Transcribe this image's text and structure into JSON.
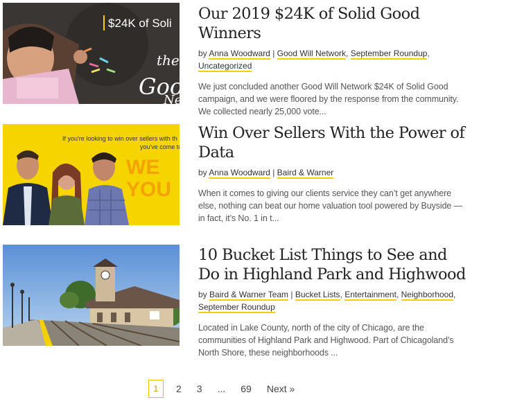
{
  "posts": [
    {
      "title": "Our 2019 $24K of Solid Good Winners",
      "by": "by ",
      "author": "Anna Woodward",
      "categories": [
        "Good Will Network",
        "September Roundup",
        "Uncategorized"
      ],
      "excerpt": "We just concluded another Good Will Network $24K of Solid Good campaign, and we were floored by the response from the community. We collected nearly 25,000 vote...",
      "thumb": {
        "overlay_text": "$24K of Soli",
        "script_text": "the Goo Ne",
        "icon": "girl-drawing-chalk-image"
      }
    },
    {
      "title": "Win Over Sellers With the Power of Data",
      "by": "by ",
      "author": "Anna Woodward",
      "categories": [
        "Baird & Warner"
      ],
      "excerpt": "When it comes to giving our clients service they can’t get anywhere else, nothing can beat our home valuation tool powered by Buyside — in fact, it’s No. 1 in t...",
      "thumb": {
        "overlay_text": "If you're looking to win over sellers with th",
        "overlay_text_2": "you've come to",
        "big_text": "WE YOU",
        "icon": "three-people-yellow-banner-image"
      }
    },
    {
      "title": "10 Bucket List Things to See and Do in Highland Park and Highwood",
      "by": "by ",
      "author": "Baird & Warner Team",
      "categories": [
        "Bucket Lists",
        "Entertainment",
        "Neighborhood",
        "September Roundup"
      ],
      "excerpt": "Located in Lake County, north of the city of Chicago, are the communities of Highland Park and Highwood. Part of Chicagoland’s North Shore, these neighborhoods ...",
      "thumb": {
        "icon": "train-station-image"
      }
    }
  ],
  "pagination": {
    "current": "1",
    "pages": [
      "2",
      "3"
    ],
    "dots": "...",
    "last": "69",
    "next": "Next »"
  },
  "colors": {
    "accent": "#f4d000",
    "title": "#222222",
    "text": "#555555"
  }
}
